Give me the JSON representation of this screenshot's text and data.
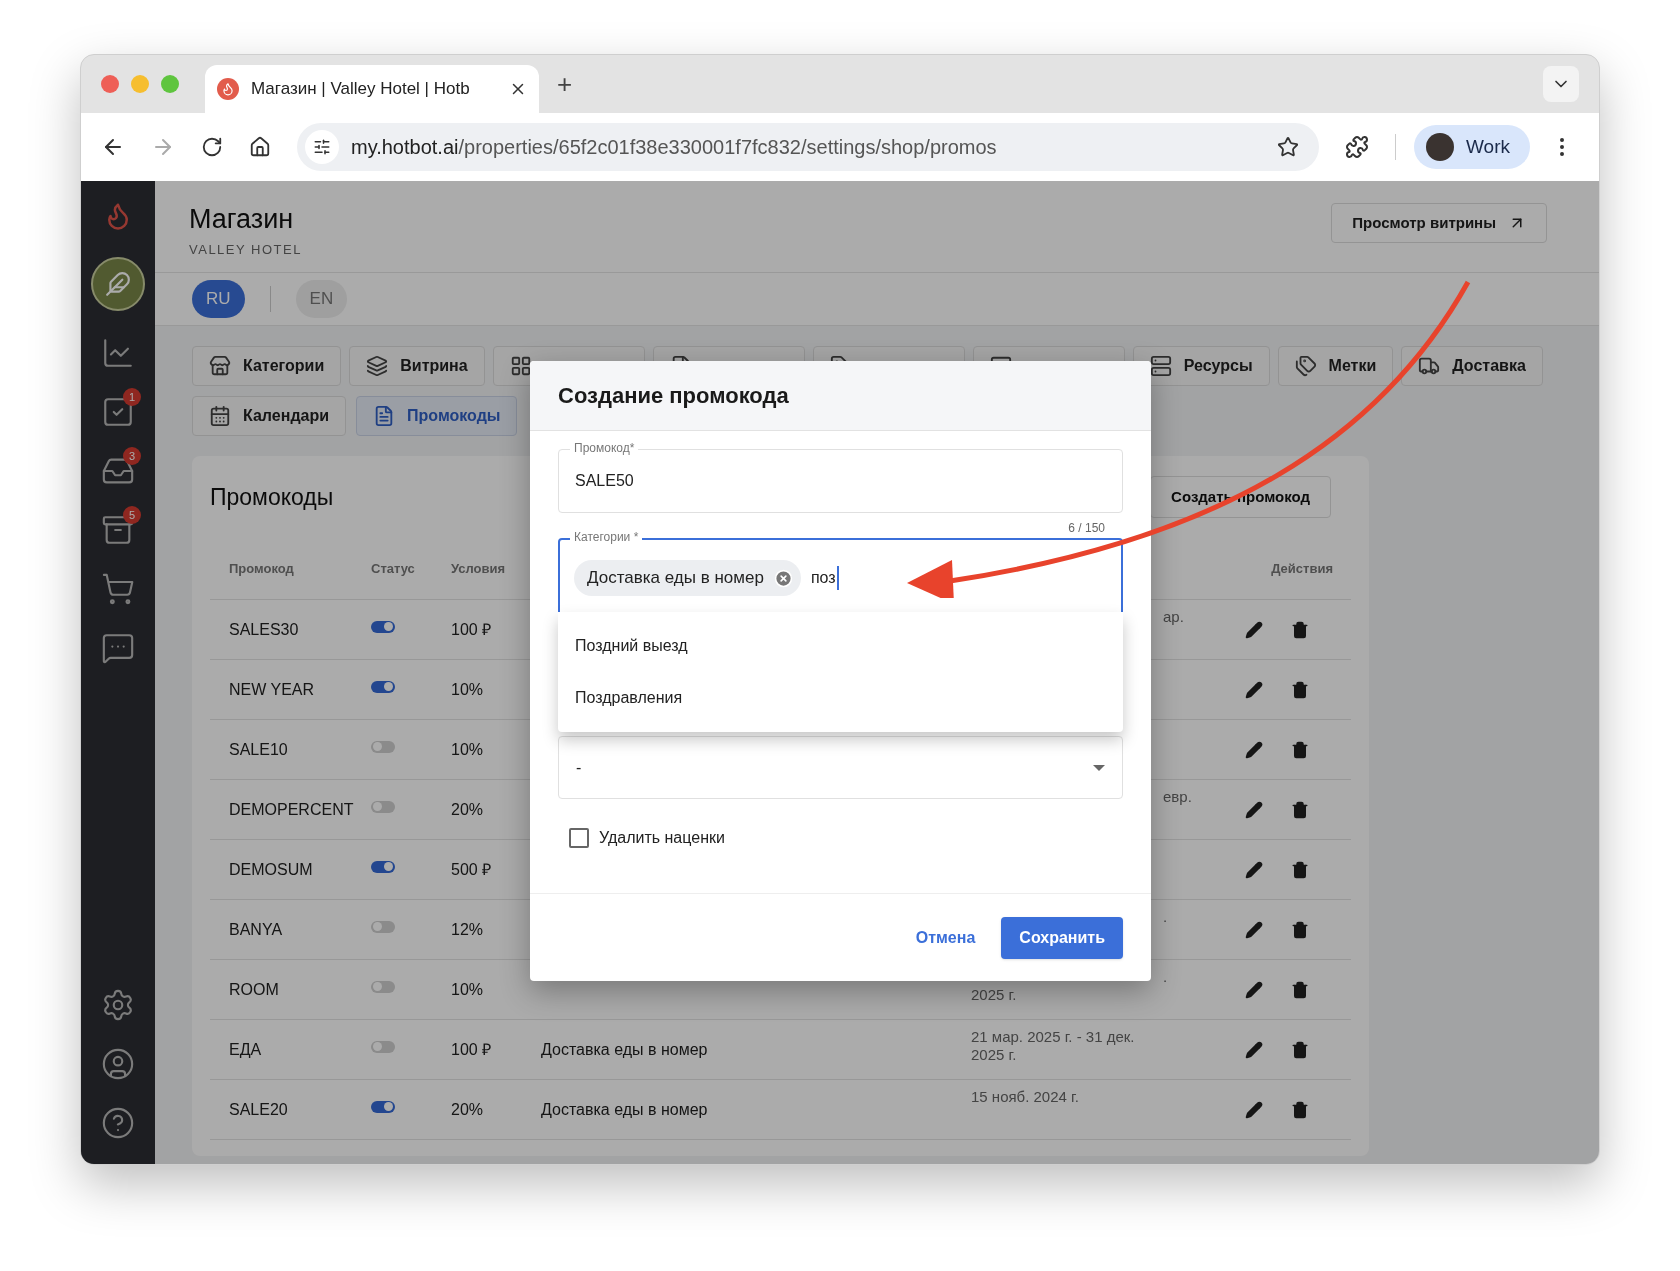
{
  "browser": {
    "tab_title": "Магазин | Valley Hotel | Hotb",
    "new_tab": "+",
    "url_host": "my.hotbot.ai",
    "url_path": "/properties/65f2c01f38e330001f7fc832/settings/shop/promos",
    "profile": "Work"
  },
  "sidebar": {
    "top": [
      {
        "kind": "chart"
      },
      {
        "kind": "tasks",
        "badge": "1"
      },
      {
        "kind": "inbox",
        "badge": "3"
      },
      {
        "kind": "reviews",
        "badge": "5"
      },
      {
        "kind": "cart"
      },
      {
        "kind": "chat"
      }
    ],
    "bottom": [
      {
        "kind": "settings"
      },
      {
        "kind": "profile"
      },
      {
        "kind": "help"
      }
    ]
  },
  "header": {
    "title": "Магазин",
    "subtitle": "VALLEY HOTEL",
    "storefront_button": "Просмотр витрины"
  },
  "languages": [
    {
      "label": "RU",
      "selected": true
    },
    {
      "label": "EN",
      "selected": false
    }
  ],
  "tabs": [
    {
      "kind": "store",
      "label": "Категории",
      "selected": false
    },
    {
      "kind": "cards",
      "label": "Витрина",
      "selected": false
    },
    {
      "kind": "grid",
      "selected": false
    },
    {
      "kind": "doc",
      "selected": false
    },
    {
      "kind": "label",
      "selected": false
    },
    {
      "kind": "screen",
      "selected": false
    },
    {
      "kind": "list",
      "label": "Ресурсы",
      "selected": false
    },
    {
      "kind": "tags",
      "label": "Метки",
      "selected": false
    },
    {
      "kind": "truck",
      "label": "Доставка",
      "selected": false
    },
    {
      "kind": "calendar",
      "label": "Календари",
      "selected": false
    },
    {
      "kind": "doc",
      "label": "Промокоды",
      "selected": true
    }
  ],
  "promos": {
    "title": "Промокоды",
    "create_button": "Создать промокод",
    "columns": {
      "code": "Промокод",
      "status": "Статус",
      "conditions": "Условия",
      "actions": "Действия"
    },
    "rows": [
      {
        "code": "SALES30",
        "on": true,
        "conditions": "100 ₽",
        "period": [
          {
            "text": "ар.",
            "cut": true
          }
        ]
      },
      {
        "code": "NEW YEAR",
        "on": true,
        "conditions": "10%"
      },
      {
        "code": "SALE10",
        "on": false,
        "conditions": "10%"
      },
      {
        "code": "DEMOPERCENT",
        "on": false,
        "conditions": "20%",
        "period": [
          {
            "text": "евр.",
            "cut": true
          }
        ]
      },
      {
        "code": "DEMOSUM",
        "on": true,
        "conditions": "500 ₽"
      },
      {
        "code": "BANYA",
        "on": false,
        "conditions": "12%",
        "period": [
          {
            "text": ".",
            "cut": true
          }
        ]
      },
      {
        "code": "ROOM",
        "on": false,
        "conditions": "10%",
        "period": [
          {
            "text": ".",
            "cut": true
          },
          {
            "text": "2025 г.",
            "cut": false
          }
        ]
      },
      {
        "code": "ЕДА",
        "on": false,
        "conditions": "100 ₽",
        "category": "Доставка еды в номер",
        "period": [
          {
            "text": "21 мар. 2025 г. - 31 дек.",
            "cut": false
          },
          {
            "text": "2025 г.",
            "cut": false
          }
        ]
      },
      {
        "code": "SALE20",
        "on": true,
        "conditions": "20%",
        "category": "Доставка еды в номер",
        "period": [
          {
            "text": "15 нояб. 2024 г.",
            "cut": false
          }
        ]
      }
    ]
  },
  "dialog": {
    "title": "Создание промокода",
    "code_field": {
      "label": "Промокод*",
      "value": "SALE50",
      "counter": "6 / 150"
    },
    "categories_field": {
      "label": "Категории *",
      "chips": [
        "Доставка еды в номер"
      ],
      "value": "поз",
      "focused": true
    },
    "suggestions": [
      "Поздний выезд",
      "Поздравления"
    ],
    "select_field": {
      "value": "-"
    },
    "remove_markups": {
      "label": "Удалить наценки",
      "checked": false
    },
    "cancel_button": "Отмена",
    "save_button": "Сохранить"
  }
}
